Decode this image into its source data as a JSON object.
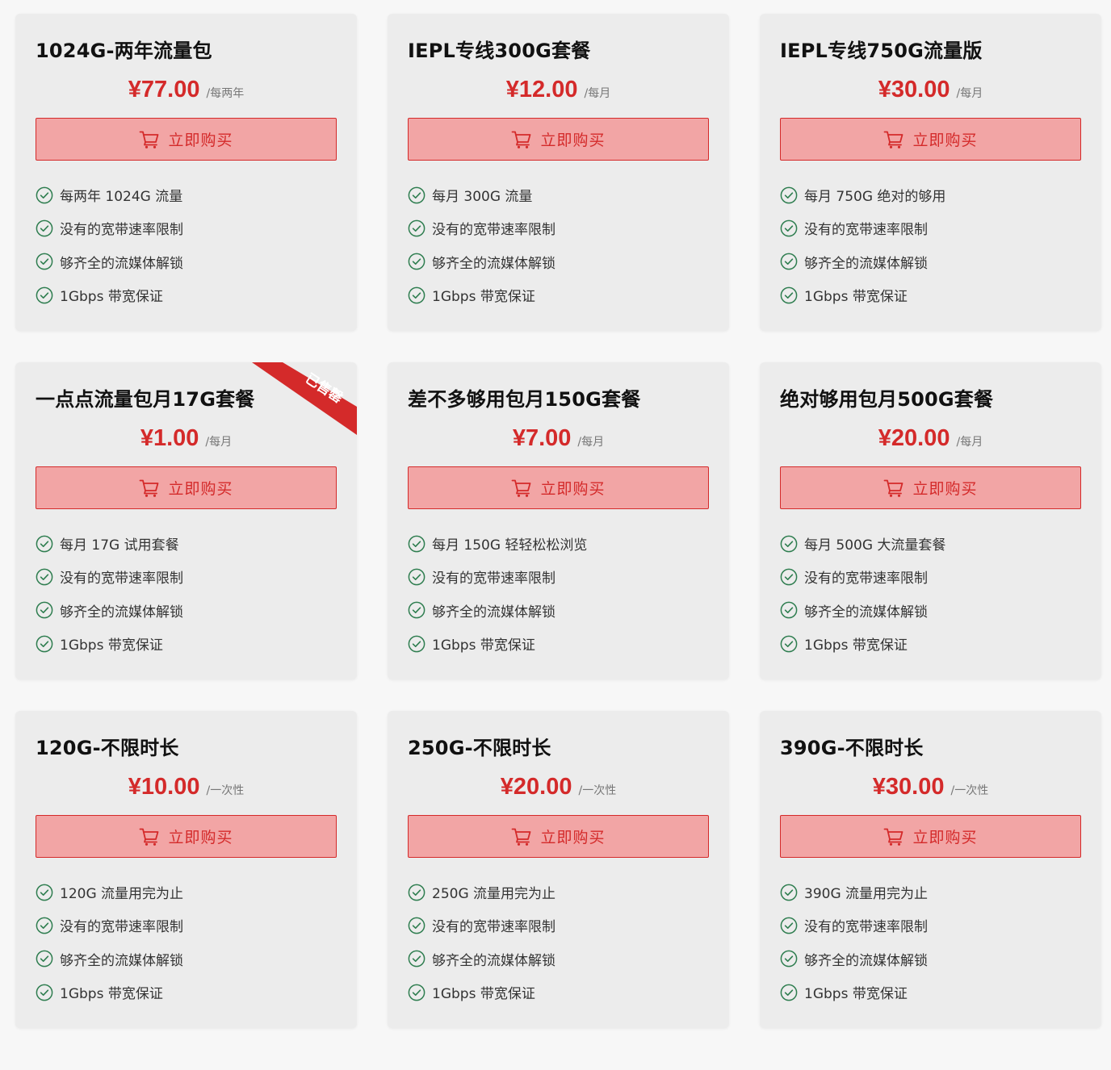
{
  "buy_label": "立即购买",
  "colors": {
    "accent": "#d42a2a",
    "button_bg": "#f2a5a5",
    "card_bg": "#ececec",
    "check": "#2e7d4f"
  },
  "icons": {
    "buy": "cart-icon",
    "feature": "check-circle-icon"
  },
  "plans": [
    {
      "title": "1024G-两年流量包",
      "price": "¥77.00",
      "period": "/每两年",
      "sold_out": false,
      "features": [
        "每两年 1024G 流量",
        "没有的宽带速率限制",
        "够齐全的流媒体解锁",
        "1Gbps 带宽保证"
      ]
    },
    {
      "title": "IEPL专线300G套餐",
      "price": "¥12.00",
      "period": "/每月",
      "sold_out": false,
      "features": [
        "每月 300G 流量",
        "没有的宽带速率限制",
        "够齐全的流媒体解锁",
        "1Gbps 带宽保证"
      ]
    },
    {
      "title": "IEPL专线750G流量版",
      "price": "¥30.00",
      "period": "/每月",
      "sold_out": false,
      "features": [
        "每月 750G 绝对的够用",
        "没有的宽带速率限制",
        "够齐全的流媒体解锁",
        "1Gbps 带宽保证"
      ]
    },
    {
      "title": "一点点流量包月17G套餐",
      "price": "¥1.00",
      "period": "/每月",
      "sold_out": true,
      "ribbon_label": "已售罄",
      "features": [
        "每月 17G 试用套餐",
        "没有的宽带速率限制",
        "够齐全的流媒体解锁",
        "1Gbps 带宽保证"
      ]
    },
    {
      "title": "差不多够用包月150G套餐",
      "price": "¥7.00",
      "period": "/每月",
      "sold_out": false,
      "features": [
        "每月 150G 轻轻松松浏览",
        "没有的宽带速率限制",
        "够齐全的流媒体解锁",
        "1Gbps 带宽保证"
      ]
    },
    {
      "title": "绝对够用包月500G套餐",
      "price": "¥20.00",
      "period": "/每月",
      "sold_out": false,
      "features": [
        "每月 500G 大流量套餐",
        "没有的宽带速率限制",
        "够齐全的流媒体解锁",
        "1Gbps 带宽保证"
      ]
    },
    {
      "title": "120G-不限时长",
      "price": "¥10.00",
      "period": "/一次性",
      "sold_out": false,
      "features": [
        "120G 流量用完为止",
        "没有的宽带速率限制",
        "够齐全的流媒体解锁",
        "1Gbps 带宽保证"
      ]
    },
    {
      "title": "250G-不限时长",
      "price": "¥20.00",
      "period": "/一次性",
      "sold_out": false,
      "features": [
        "250G 流量用完为止",
        "没有的宽带速率限制",
        "够齐全的流媒体解锁",
        "1Gbps 带宽保证"
      ]
    },
    {
      "title": "390G-不限时长",
      "price": "¥30.00",
      "period": "/一次性",
      "sold_out": false,
      "features": [
        "390G 流量用完为止",
        "没有的宽带速率限制",
        "够齐全的流媒体解锁",
        "1Gbps 带宽保证"
      ]
    }
  ]
}
